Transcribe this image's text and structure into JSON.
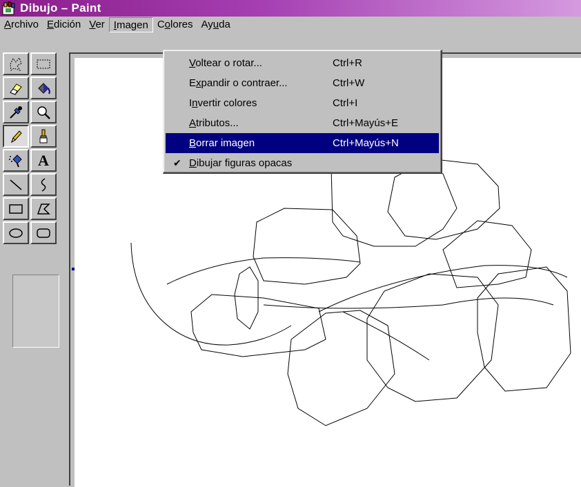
{
  "window": {
    "title": "Dibujo – Paint"
  },
  "menubar": [
    {
      "pre": "",
      "ul": "A",
      "post": "rchivo"
    },
    {
      "pre": "",
      "ul": "E",
      "post": "dición"
    },
    {
      "pre": "",
      "ul": "V",
      "post": "er"
    },
    {
      "pre": "",
      "ul": "I",
      "post": "magen"
    },
    {
      "pre": "C",
      "ul": "o",
      "post": "lores"
    },
    {
      "pre": "Ay",
      "ul": "u",
      "post": "da"
    }
  ],
  "imagen_menu": {
    "items": [
      {
        "pre": "",
        "ul": "V",
        "post": "oltear o rotar...",
        "shortcut": "Ctrl+R",
        "checked": false,
        "highlighted": false
      },
      {
        "pre": "E",
        "ul": "x",
        "post": "pandir o contraer...",
        "shortcut": "Ctrl+W",
        "checked": false,
        "highlighted": false
      },
      {
        "pre": "I",
        "ul": "n",
        "post": "vertir colores",
        "shortcut": "Ctrl+I",
        "checked": false,
        "highlighted": false
      },
      {
        "pre": "",
        "ul": "A",
        "post": "tributos...",
        "shortcut": "Ctrl+Mayús+E",
        "checked": false,
        "highlighted": false
      },
      {
        "pre": "",
        "ul": "B",
        "post": "orrar imagen",
        "shortcut": "Ctrl+Mayús+N",
        "checked": false,
        "highlighted": true
      },
      {
        "pre": "",
        "ul": "D",
        "post": "ibujar figuras opacas",
        "shortcut": "",
        "checked": true,
        "highlighted": false
      }
    ]
  },
  "tools": [
    "free-select-icon",
    "rect-select-icon",
    "eraser-icon",
    "fill-bucket-icon",
    "color-picker-icon",
    "magnifier-icon",
    "pencil-icon",
    "brush-icon",
    "airbrush-icon",
    "text-icon",
    "line-icon",
    "curve-icon",
    "rectangle-icon",
    "polygon-icon",
    "ellipse-icon",
    "rounded-rect-icon"
  ],
  "selected_tool": "pencil-icon",
  "toolbar_text": {
    "text_tool_glyph": "A"
  },
  "colors": {
    "title_start": "#8a1d8a",
    "title_end": "#d59ae0",
    "highlight": "#000080",
    "face": "#c0c0c0"
  }
}
